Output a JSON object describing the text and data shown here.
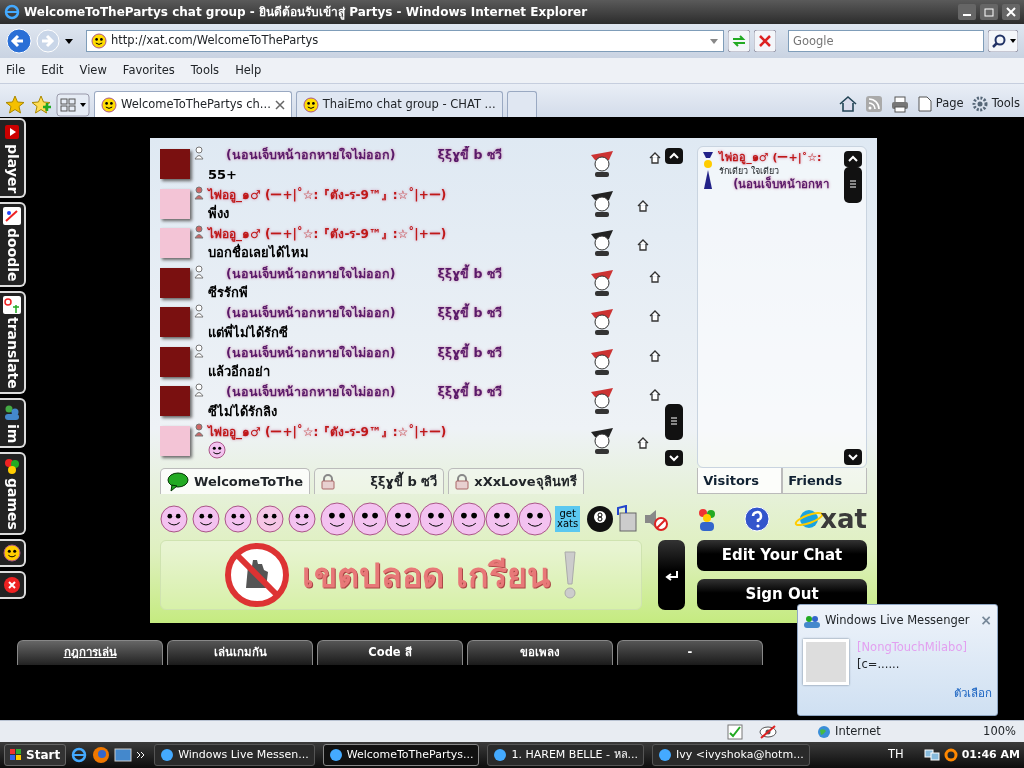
{
  "window": {
    "title": "WelcomeToThePartys chat group - ยินดีต้อนรับเข้าสู่ Partys - Windows Internet Explorer"
  },
  "address": {
    "url": "http://xat.com/WelcomeToThePartys"
  },
  "search": {
    "placeholder": "Google"
  },
  "menu": [
    "File",
    "Edit",
    "View",
    "Favorites",
    "Tools",
    "Help"
  ],
  "browser_tabs": [
    {
      "label": "WelcomeToThePartys ch...",
      "selected": true
    },
    {
      "label": "ThaiEmo chat group - CHAT ...",
      "selected": false
    }
  ],
  "command_bar": [
    "Page",
    "Tools"
  ],
  "side_apps": [
    "player",
    "doodle",
    "translate",
    "im",
    "games"
  ],
  "chat": {
    "messages": [
      {
        "kind": "purple",
        "name": "(นอนเจ็บหน้าอกหายใจไม่ออก)",
        "name2": "ξξɣขี้ b ซวี",
        "text": "55+"
      },
      {
        "kind": "red",
        "name": "ไพ่ออู_๑♂ (ー+|˚☆:『ตัง-ร-9™』:☆˚|+ー)",
        "text": "พี่งง"
      },
      {
        "kind": "red",
        "name": "ไพ่ออู_๑♂ (ー+|˚☆:『ตัง-ร-9™』:☆˚|+ー)",
        "text": "บอกชื่อเลยได้ไหม"
      },
      {
        "kind": "purple",
        "name": "(นอนเจ็บหน้าอกหายใจไม่ออก)",
        "name2": "ξξɣขี้ b ซวี",
        "text": "ซีรรักพี"
      },
      {
        "kind": "purple",
        "name": "(นอนเจ็บหน้าอกหายใจไม่ออก)",
        "name2": "ξξɣขี้ b ซวี",
        "text": "แต่พี่ไม่ได้รักซี"
      },
      {
        "kind": "purple",
        "name": "(นอนเจ็บหน้าอกหายใจไม่ออก)",
        "name2": "ξξɣขี้ b ซวี",
        "text": "แล้วอีกอย่า"
      },
      {
        "kind": "purple",
        "name": "(นอนเจ็บหน้าอกหายใจไม่ออก)",
        "name2": "ξξɣขี้ b ซวี",
        "text": "ซีไม่ได้รักลิง"
      },
      {
        "kind": "red",
        "name": "ไพ่ออู_๑♂ (ー+|˚☆:『ตัง-ร-9™』:☆˚|+ー)",
        "smiley": true
      }
    ],
    "tabs": [
      {
        "kind": "main",
        "label": "WelcomeToThe",
        "selected": true
      },
      {
        "kind": "private",
        "label": "ξξɣขี้ b ซวี",
        "selected": false
      },
      {
        "kind": "private",
        "label": "xXxLoveจุลินทรี",
        "selected": false
      }
    ],
    "users": [
      {
        "name": "ไพ่ออู_๑♂ (ー+|˚☆:",
        "status": "รักเดียว ใจเดียว",
        "name2": "(นอนเจ็บหน้าอกหา"
      }
    ],
    "list_tabs": [
      {
        "label": "Visitors",
        "selected": true
      },
      {
        "label": "Friends",
        "selected": false
      }
    ],
    "get_xats": "get xats",
    "logo": "xat",
    "banner": "เขตปลอด เกรียน",
    "buttons": [
      "Edit Your Chat",
      "Sign Out"
    ]
  },
  "page_tabs": [
    {
      "label": "กฎการเล่น",
      "selected": true
    },
    {
      "label": "เล่นเกมกัน",
      "selected": false
    },
    {
      "label": "Code สี",
      "selected": false
    },
    {
      "label": "ขอเพลง",
      "selected": false
    },
    {
      "label": "-",
      "selected": false
    }
  ],
  "messenger": {
    "title": "Windows Live Messenger",
    "close": "×",
    "name": "[NongTouchMilabo]",
    "message": "[c=......",
    "options": "ตัวเลือก"
  },
  "status_bar": {
    "zone": "Internet",
    "zoom": "100%"
  },
  "taskbar": {
    "start": "Start",
    "items": [
      {
        "label": "Windows Live Messen...",
        "selected": false
      },
      {
        "label": "WelcomeToThePartys...",
        "selected": true
      },
      {
        "label": "1. HAREM BELLE - หล...",
        "selected": false
      },
      {
        "label": "Ivy <ivyshoka@hotm...",
        "selected": false
      }
    ],
    "language": "TH",
    "clock": "01:46 AM"
  }
}
